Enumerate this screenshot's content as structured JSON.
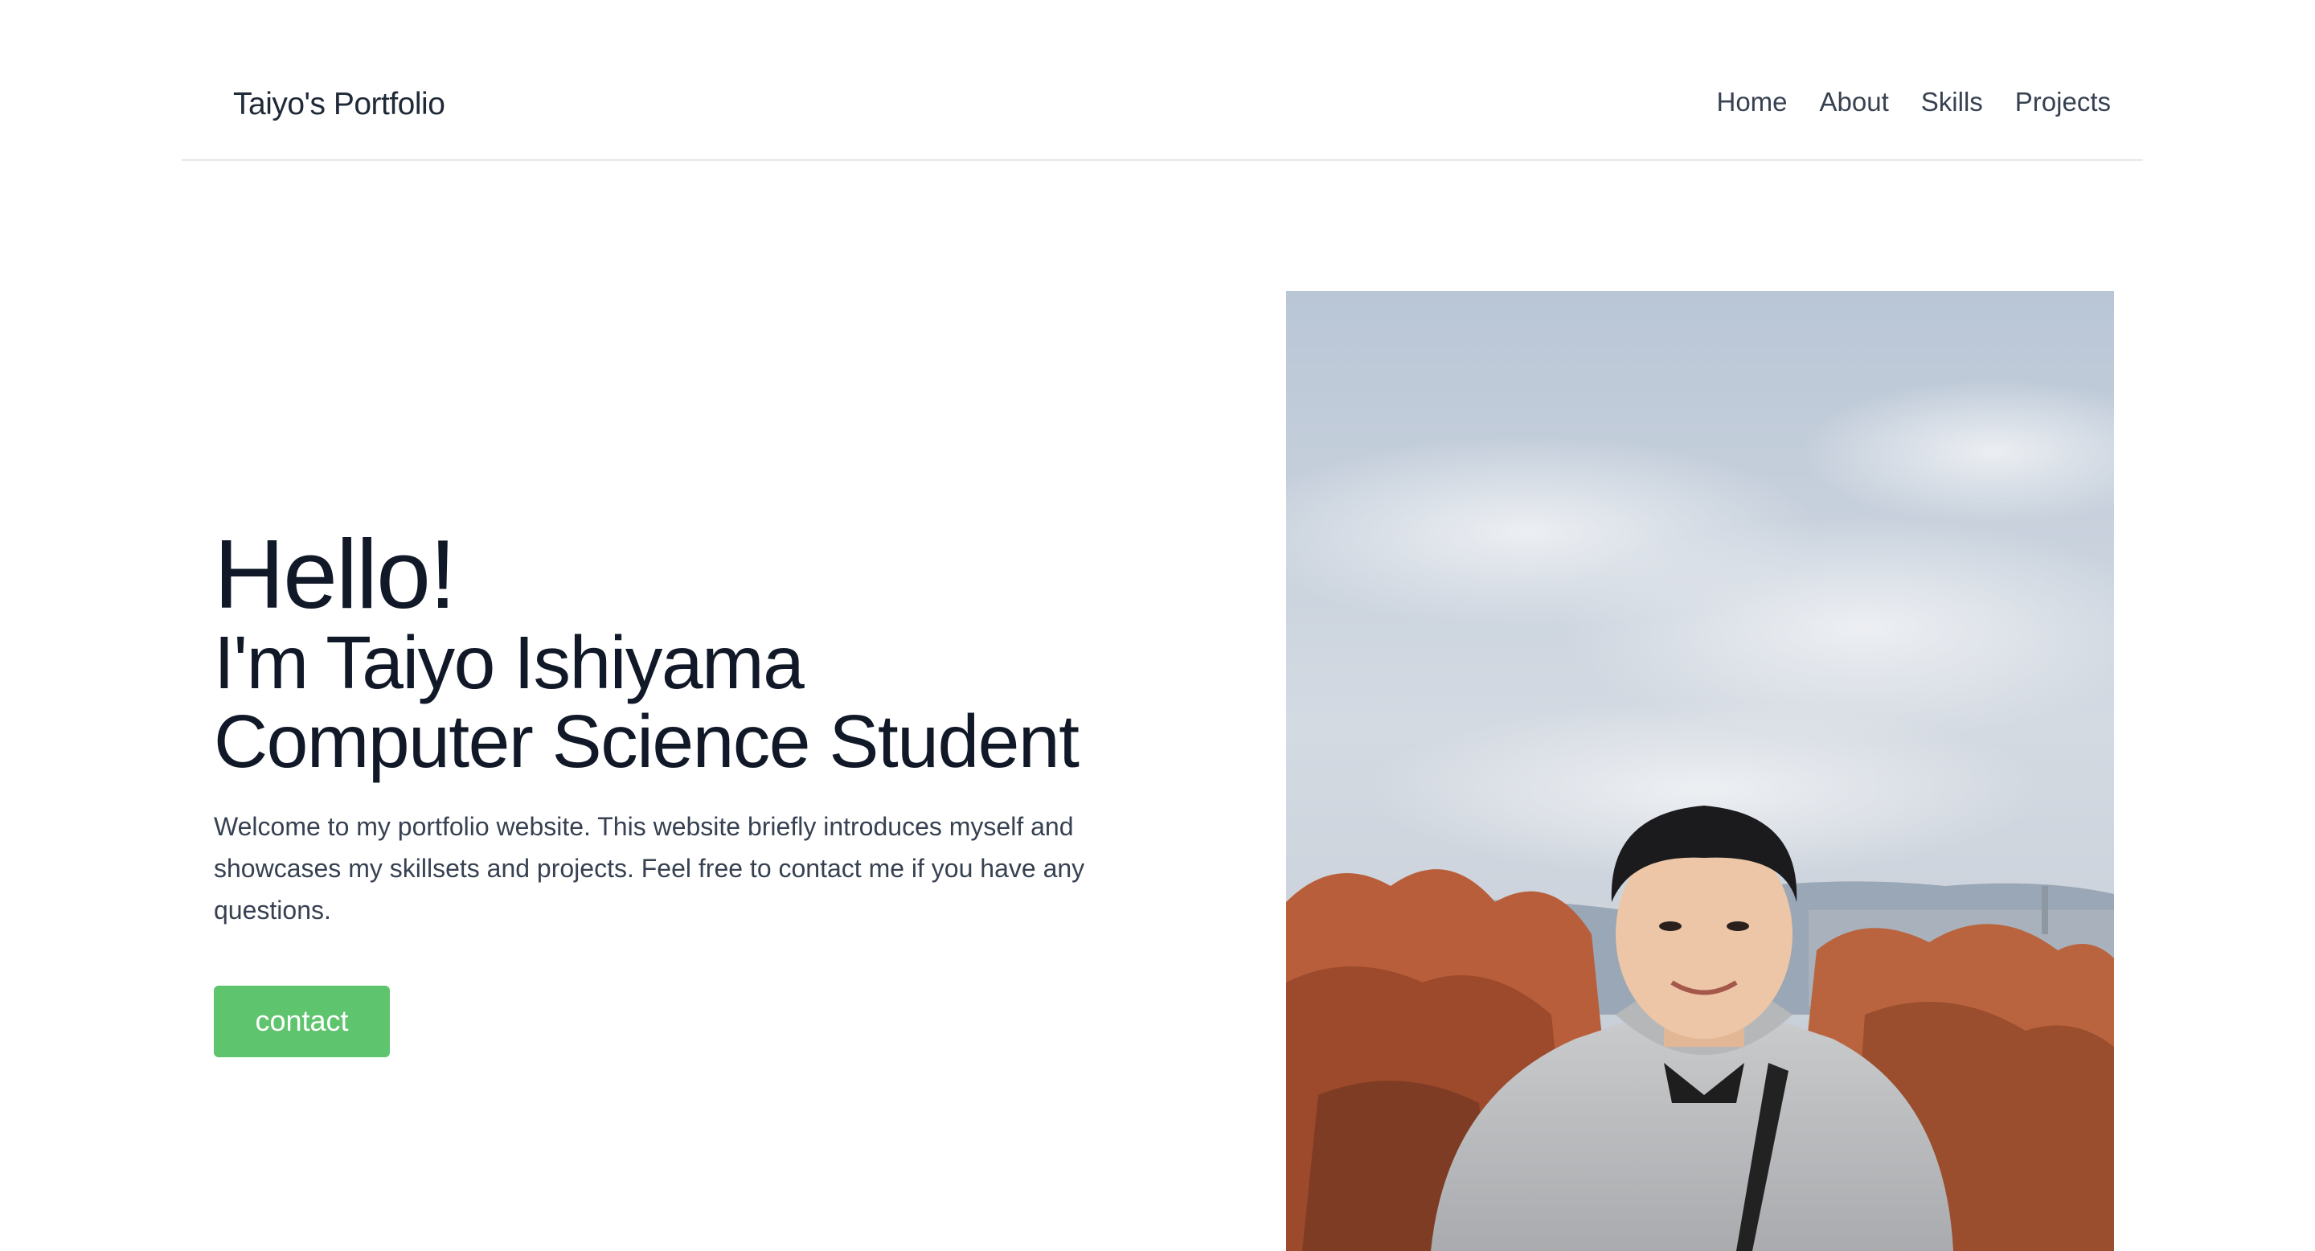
{
  "header": {
    "brand": "Taiyo's Portfolio",
    "nav": [
      "Home",
      "About",
      "Skills",
      "Projects"
    ]
  },
  "hero": {
    "greeting": "Hello!",
    "name_line": "I'm Taiyo Ishiyama",
    "role_line": "Computer Science Student",
    "intro": "Welcome to my portfolio website. This website briefly introduces myself and showcases my skillsets and projects. Feel free to contact me if you have any questions.",
    "contact_label": "contact"
  },
  "colors": {
    "accent": "#5fc46e",
    "heading": "#111827",
    "body_text": "#374151",
    "divider": "#e5e7eb"
  }
}
